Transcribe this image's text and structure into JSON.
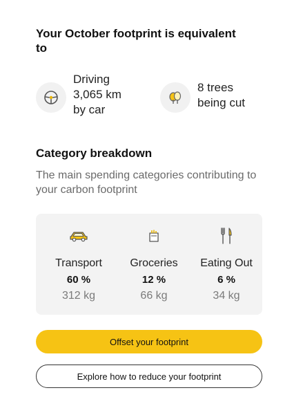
{
  "footprint": {
    "title": "Your October footprint is equivalent to",
    "equivalents": [
      {
        "icon": "steering-wheel-icon",
        "text": "Driving\n3,065 km\nby car"
      },
      {
        "icon": "tree-icon",
        "text": "8 trees\nbeing cut"
      }
    ]
  },
  "breakdown": {
    "title": "Category breakdown",
    "subtitle": "The main spending categories contributing to your carbon footprint",
    "categories": [
      {
        "name": "Transport",
        "percent": "60 %",
        "weight": "312 kg",
        "icon": "car-icon"
      },
      {
        "name": "Groceries",
        "percent": "12 %",
        "weight": "66 kg",
        "icon": "shopping-bag-icon"
      },
      {
        "name": "Eating Out",
        "percent": "6 %",
        "weight": "34 kg",
        "icon": "fork-knife-icon"
      }
    ]
  },
  "actions": {
    "offset_label": "Offset your footprint",
    "explore_label": "Explore how to reduce your footprint"
  },
  "colors": {
    "accent": "#f6c314",
    "card_bg": "#f3f3f3",
    "icon_bg": "#f1f1f1"
  }
}
